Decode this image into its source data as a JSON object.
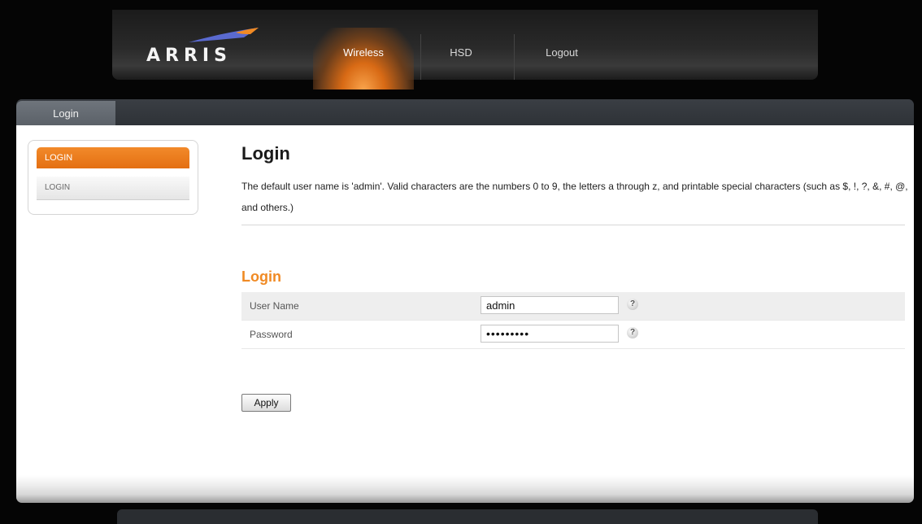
{
  "header": {
    "brand": "ARRIS",
    "nav": [
      {
        "label": "Wireless",
        "active": true
      },
      {
        "label": "HSD",
        "active": false
      },
      {
        "label": "Logout",
        "active": false
      }
    ],
    "accent_color": "#e46f12"
  },
  "tabs": {
    "active_label": "Login"
  },
  "sidebar": {
    "heading": "LOGIN",
    "items": [
      {
        "label": "LOGIN"
      }
    ]
  },
  "main": {
    "title": "Login",
    "intro": "The default user name is 'admin'. Valid characters are the numbers 0 to 9, the letters a through z, and printable special characters (such as $, !, ?, &, #, @, and others.)",
    "section_title": "Login",
    "fields": {
      "username": {
        "label": "User Name",
        "value": "admin",
        "help": "?"
      },
      "password": {
        "label": "Password",
        "value": "•••••••••",
        "help": "?"
      }
    },
    "apply_label": "Apply"
  }
}
